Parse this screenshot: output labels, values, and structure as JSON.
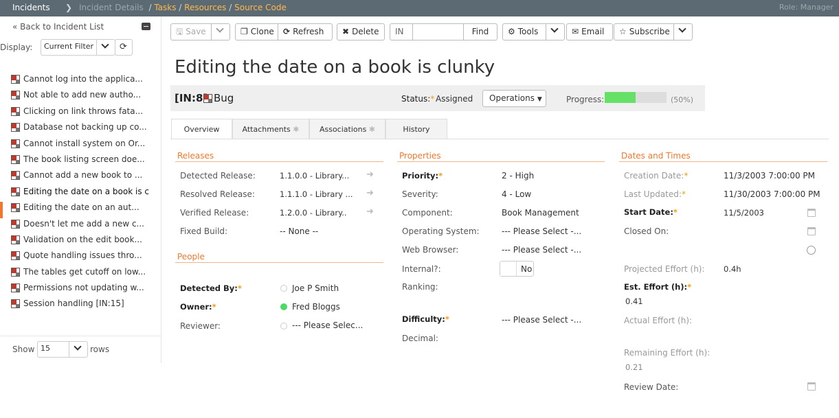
{
  "breadcrumb": {
    "main": "Incidents",
    "details": "Incident Details",
    "links": [
      "Tasks",
      "Resources",
      "Source Code"
    ],
    "role": "Role: Manager"
  },
  "sidebar": {
    "back_label": "« Back to Incident List",
    "display_label": "Display:",
    "filter_value": "Current Filter",
    "items": [
      {
        "label": "Cannot log into the applica..."
      },
      {
        "label": "Not able to add new autho..."
      },
      {
        "label": "Clicking on link throws fata..."
      },
      {
        "label": "Database not backing up co..."
      },
      {
        "label": "Cannot install system on Or..."
      },
      {
        "label": "The book listing screen doe..."
      },
      {
        "label": "Cannot add a new book to ..."
      },
      {
        "label": "Editing the date on a book is c"
      },
      {
        "label": "Editing the date on an aut..."
      },
      {
        "label": "Doesn't let me add a new c..."
      },
      {
        "label": "Validation on the edit book..."
      },
      {
        "label": "Quote handling issues thro..."
      },
      {
        "label": "The tables get cutoff on low..."
      },
      {
        "label": "Permissions not updating w..."
      },
      {
        "label": "Session handling [IN:15]"
      }
    ],
    "show_label": "Show",
    "rows_value": "15",
    "rows_label": "rows"
  },
  "toolbar": {
    "save": "Save",
    "clone": "Clone",
    "refresh": "Refresh",
    "delete": "Delete",
    "find_prefix": "IN",
    "find": "Find",
    "tools": "Tools",
    "email": "Email",
    "subscribe": "Subscribe"
  },
  "incident": {
    "title": "Editing the date on a book is clunky",
    "id": "[IN:8]",
    "type": "Bug",
    "status_label": "Status:",
    "status": "Assigned",
    "operations": "Operations",
    "progress_label": "Progress:",
    "progress_value": 0.5,
    "progress_text": "(50%)"
  },
  "tabs": [
    "Overview",
    "Attachments",
    "Associations",
    "History"
  ],
  "releases": {
    "title": "Releases",
    "rows": [
      {
        "label": "Detected Release:",
        "value": "1.1.0.0 - Library..."
      },
      {
        "label": "Resolved Release:",
        "value": "1.1.1.0 - Library ..."
      },
      {
        "label": "Verified Release:",
        "value": "1.2.0.0 - Library.."
      },
      {
        "label": "Fixed Build:",
        "value": "-- None --"
      }
    ]
  },
  "people": {
    "title": "People",
    "rows": [
      {
        "label": "Detected By:",
        "value": "Joe P Smith"
      },
      {
        "label": "Owner:",
        "value": "Fred Bloggs"
      },
      {
        "label": "Reviewer:",
        "value": "--- Please Selec..."
      }
    ]
  },
  "properties": {
    "title": "Properties",
    "rows": [
      {
        "label": "Priority:",
        "value": "2 - High"
      },
      {
        "label": "Severity:",
        "value": "4 - Low"
      },
      {
        "label": "Component:",
        "value": "Book Management"
      },
      {
        "label": "Operating System:",
        "value": "--- Please Select -..."
      },
      {
        "label": "Web Browser:",
        "value": "--- Please Select -..."
      },
      {
        "label": "Internal?:",
        "value": "No"
      },
      {
        "label": "Ranking:",
        "value": ""
      },
      {
        "label": "Difficulty:",
        "value": "--- Please Select -..."
      },
      {
        "label": "Decimal:",
        "value": ""
      }
    ]
  },
  "dates": {
    "title": "Dates and Times",
    "creation_label": "Creation Date:",
    "creation": "11/3/2003 7:00:00 PM",
    "updated_label": "Last Updated:",
    "updated": "11/30/2003 7:00:00 PM",
    "start_label": "Start Date:",
    "start": "11/5/2003",
    "closed_label": "Closed On:",
    "projected_label": "Projected Effort (h):",
    "projected": "0.4h",
    "est_label": "Est. Effort (h):",
    "est": "0.41",
    "actual_label": "Actual Effort (h):",
    "remaining_label": "Remaining Effort (h):",
    "remaining": "0.21",
    "review_label": "Review Date:"
  },
  "colors": {
    "accent": "#f0782c",
    "topbar": "#5c6b73",
    "progress": "#66e066"
  }
}
